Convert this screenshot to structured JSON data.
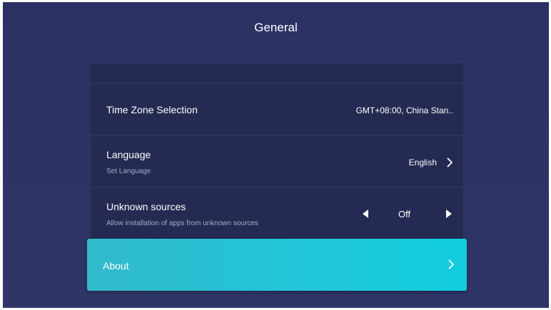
{
  "page": {
    "title": "General"
  },
  "rows": {
    "time_zone": {
      "label": "Time Zone Selection",
      "value": "GMT+08:00, China Stan.."
    },
    "language": {
      "label": "Language",
      "sub": "Set Language",
      "value": "English"
    },
    "unknown_sources": {
      "label": "Unknown sources",
      "sub": "Allow installation of apps from unknown sources",
      "value": "Off"
    },
    "about": {
      "label": "About"
    }
  },
  "colors": {
    "background": "#2f3566",
    "row_bg": "#242a52",
    "accent": "#20c7d9",
    "text": "#ffffff",
    "subtext": "#a6abc6"
  },
  "icons": {
    "language_chevron": "chevron-right-icon",
    "unknown_left": "triangle-left-icon",
    "unknown_right": "triangle-right-icon",
    "about_chevron": "chevron-right-icon"
  }
}
